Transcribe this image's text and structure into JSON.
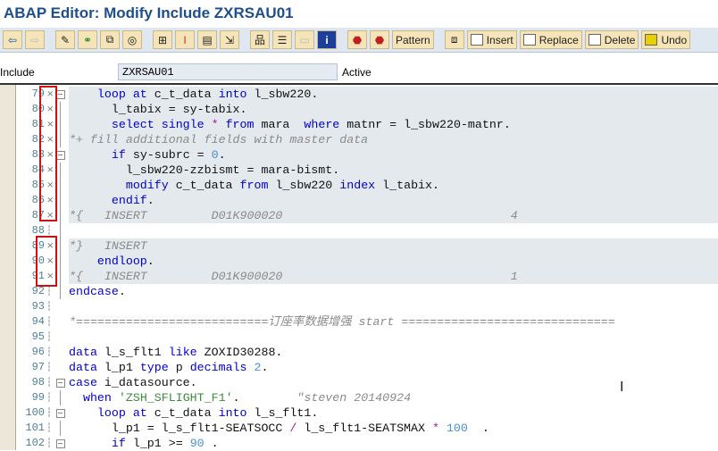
{
  "title": "ABAP Editor: Modify Include ZXRSAU01",
  "toolbar": {
    "icons": [
      "back-icon",
      "forward-icon",
      "edit-icon",
      "toggle-icon",
      "other-object-icon",
      "where-used-icon",
      "hierarchy-icon",
      "info-icon",
      "display-list-icon",
      "navigate-icon",
      "object-list-icon",
      "layout-icon",
      "blank-icon",
      "help-info-icon",
      "breakpoint-icon",
      "session-breakpoint-icon"
    ],
    "pattern": "Pattern",
    "insert": "Insert",
    "replace": "Replace",
    "delete": "Delete",
    "undo": "Undo"
  },
  "include": {
    "label": "Include",
    "value": "ZXRSAU01",
    "status": "Active"
  },
  "lines": [
    {
      "n": "79",
      "shade": true,
      "mark": true,
      "fold": "box",
      "seg": [
        [
          "t",
          "    "
        ],
        [
          "k",
          "loop at "
        ],
        [
          "t",
          "c_t_data "
        ],
        [
          "k",
          "into "
        ],
        [
          "t",
          "l_sbw220."
        ]
      ]
    },
    {
      "n": "80",
      "shade": true,
      "mark": true,
      "fold": "ln",
      "seg": [
        [
          "t",
          "      l_tabix = sy-tabix."
        ]
      ]
    },
    {
      "n": "81",
      "shade": true,
      "mark": true,
      "fold": "ln",
      "seg": [
        [
          "t",
          "      "
        ],
        [
          "k",
          "select single "
        ],
        [
          "p",
          "* "
        ],
        [
          "k",
          "from "
        ],
        [
          "t",
          "mara  "
        ],
        [
          "k",
          "where "
        ],
        [
          "t",
          "matnr = l_sbw220-matnr."
        ]
      ]
    },
    {
      "n": "82",
      "shade": true,
      "mark": true,
      "fold": "ln",
      "seg": [
        [
          "c",
          "*+ fill additional fields with master data"
        ]
      ]
    },
    {
      "n": "83",
      "shade": true,
      "mark": true,
      "fold": "box",
      "seg": [
        [
          "t",
          "      "
        ],
        [
          "k",
          "if "
        ],
        [
          "t",
          "sy-subrc = "
        ],
        [
          "n",
          "0"
        ],
        [
          "t",
          "."
        ]
      ]
    },
    {
      "n": "84",
      "shade": true,
      "mark": true,
      "fold": "ln",
      "seg": [
        [
          "t",
          "        l_sbw220-zzbismt = mara-bismt."
        ]
      ]
    },
    {
      "n": "85",
      "shade": true,
      "mark": true,
      "fold": "ln",
      "seg": [
        [
          "t",
          "        "
        ],
        [
          "k",
          "modify "
        ],
        [
          "t",
          "c_t_data "
        ],
        [
          "k",
          "from "
        ],
        [
          "t",
          "l_sbw220 "
        ],
        [
          "k",
          "index "
        ],
        [
          "t",
          "l_tabix."
        ]
      ]
    },
    {
      "n": "86",
      "shade": true,
      "mark": true,
      "fold": "ln",
      "seg": [
        [
          "t",
          "      "
        ],
        [
          "k",
          "endif"
        ],
        [
          "t",
          "."
        ]
      ]
    },
    {
      "n": "87",
      "shade": true,
      "mark": true,
      "fold": "ln",
      "seg": [
        [
          "c",
          "*{   INSERT         D01K900020                                4"
        ]
      ]
    },
    {
      "n": "88",
      "shade": false,
      "mark": false,
      "fold": "ln",
      "seg": [
        [
          "t",
          ""
        ]
      ]
    },
    {
      "n": "89",
      "shade": true,
      "mark": true,
      "fold": "ln",
      "seg": [
        [
          "c",
          "*}   INSERT"
        ]
      ]
    },
    {
      "n": "90",
      "shade": true,
      "mark": true,
      "fold": "ln",
      "seg": [
        [
          "t",
          "    "
        ],
        [
          "k",
          "endloop"
        ],
        [
          "t",
          "."
        ]
      ]
    },
    {
      "n": "91",
      "shade": true,
      "mark": true,
      "fold": "ln",
      "seg": [
        [
          "c",
          "*{   INSERT         D01K900020                                1"
        ]
      ]
    },
    {
      "n": "92",
      "shade": false,
      "mark": false,
      "fold": "end",
      "seg": [
        [
          "k",
          "endcase"
        ],
        [
          "t",
          "."
        ]
      ]
    },
    {
      "n": "93",
      "shade": false,
      "mark": false,
      "fold": "",
      "seg": [
        [
          "t",
          ""
        ]
      ]
    },
    {
      "n": "94",
      "shade": false,
      "mark": false,
      "fold": "",
      "seg": [
        [
          "c",
          "*===========================订座率数据增强 start =============================="
        ]
      ]
    },
    {
      "n": "95",
      "shade": false,
      "mark": false,
      "fold": "",
      "seg": [
        [
          "t",
          ""
        ]
      ]
    },
    {
      "n": "96",
      "shade": false,
      "mark": false,
      "fold": "",
      "seg": [
        [
          "k",
          "data "
        ],
        [
          "t",
          "l_s_flt1 "
        ],
        [
          "k",
          "like "
        ],
        [
          "t",
          "ZOXID30288."
        ]
      ]
    },
    {
      "n": "97",
      "shade": false,
      "mark": false,
      "fold": "",
      "seg": [
        [
          "k",
          "data "
        ],
        [
          "t",
          "l_p1 "
        ],
        [
          "k",
          "type "
        ],
        [
          "t",
          "p "
        ],
        [
          "k",
          "decimals "
        ],
        [
          "n",
          "2"
        ],
        [
          "t",
          "."
        ]
      ]
    },
    {
      "n": "98",
      "shade": false,
      "mark": false,
      "fold": "box",
      "seg": [
        [
          "k",
          "case "
        ],
        [
          "t",
          "i_datasource."
        ]
      ]
    },
    {
      "n": "99",
      "shade": false,
      "mark": false,
      "fold": "ln",
      "seg": [
        [
          "t",
          "  "
        ],
        [
          "k",
          "when "
        ],
        [
          "s",
          "'ZSH_SFLIGHT_F1'"
        ],
        [
          "t",
          ".        "
        ],
        [
          "c",
          "\"steven 20140924"
        ]
      ]
    },
    {
      "n": "100",
      "shade": false,
      "mark": false,
      "fold": "box",
      "seg": [
        [
          "t",
          "    "
        ],
        [
          "k",
          "loop at "
        ],
        [
          "t",
          "c_t_data "
        ],
        [
          "k",
          "into "
        ],
        [
          "t",
          "l_s_flt1."
        ]
      ]
    },
    {
      "n": "101",
      "shade": false,
      "mark": false,
      "fold": "ln",
      "seg": [
        [
          "t",
          "      l_p1 = l_s_flt1-SEATSOCC "
        ],
        [
          "p",
          "/ "
        ],
        [
          "t",
          "l_s_flt1-SEATSMAX "
        ],
        [
          "p",
          "* "
        ],
        [
          "n",
          "100"
        ],
        [
          "t",
          "  ."
        ]
      ]
    },
    {
      "n": "102",
      "shade": false,
      "mark": false,
      "fold": "box",
      "seg": [
        [
          "t",
          "      "
        ],
        [
          "k",
          "if "
        ],
        [
          "t",
          "l_p1 >= "
        ],
        [
          "n",
          "90"
        ],
        [
          "t",
          " ."
        ]
      ]
    }
  ]
}
